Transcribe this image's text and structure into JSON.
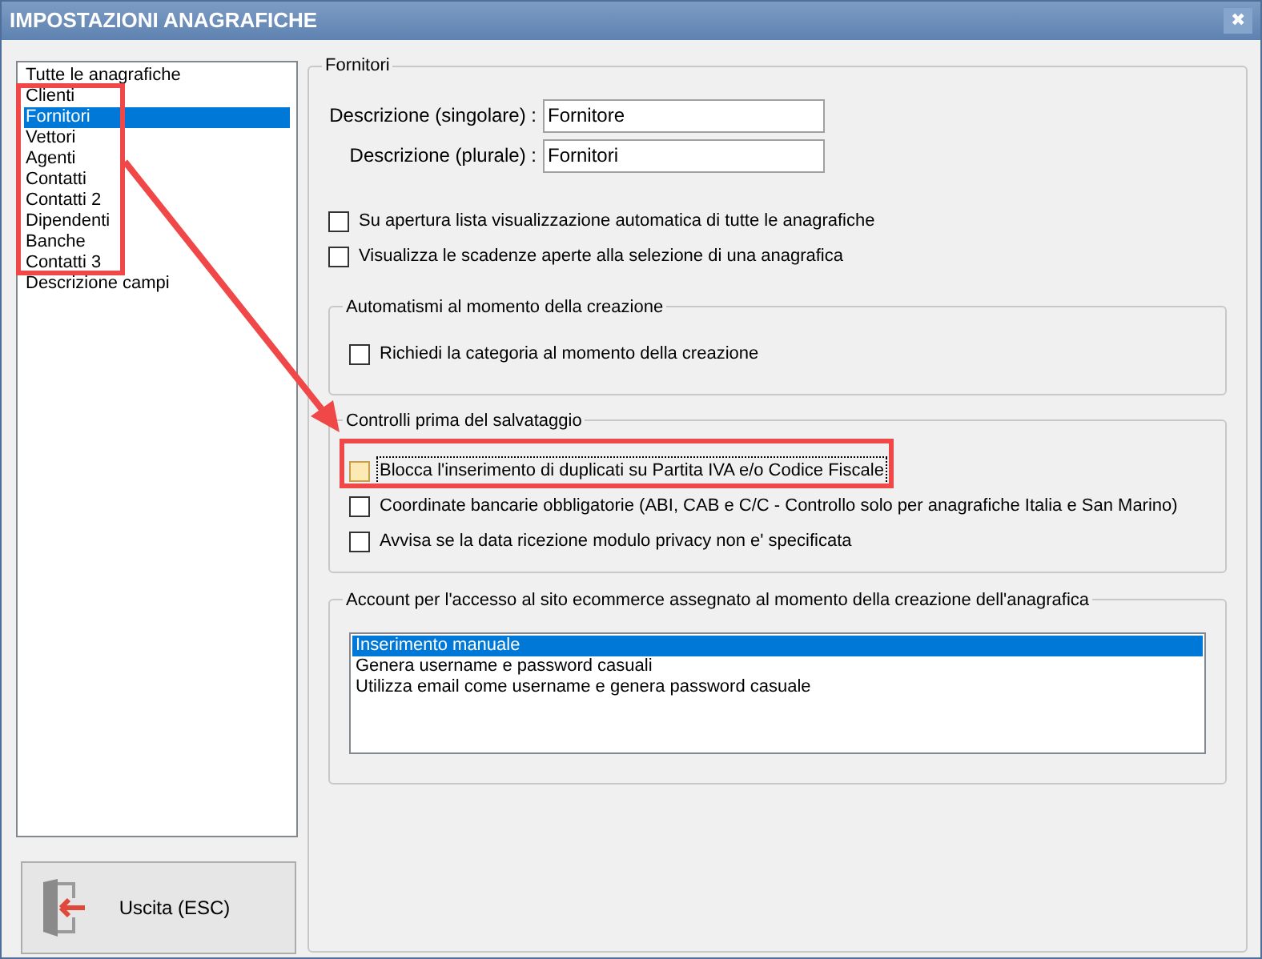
{
  "window": {
    "title": "IMPOSTAZIONI ANAGRAFICHE",
    "close": "✖"
  },
  "sidebar": {
    "items": [
      {
        "label": "Tutte le anagrafiche",
        "selected": false
      },
      {
        "label": "Clienti",
        "selected": false
      },
      {
        "label": "Fornitori",
        "selected": true
      },
      {
        "label": "Vettori",
        "selected": false
      },
      {
        "label": "Agenti",
        "selected": false
      },
      {
        "label": "Contatti",
        "selected": false
      },
      {
        "label": "Contatti 2",
        "selected": false
      },
      {
        "label": "Dipendenti",
        "selected": false
      },
      {
        "label": "Banche",
        "selected": false
      },
      {
        "label": "Contatti 3",
        "selected": false
      },
      {
        "label": "Descrizione campi",
        "selected": false
      }
    ]
  },
  "exit_button": "Uscita (ESC)",
  "panel": {
    "title": "Fornitori",
    "fields": [
      {
        "label": "Descrizione (singolare) :",
        "value": "Fornitore"
      },
      {
        "label": "Descrizione (plurale) :",
        "value": "Fornitori"
      }
    ],
    "options": [
      {
        "label": "Su apertura lista visualizzazione automatica di tutte le anagrafiche",
        "checked": false,
        "focused": false
      },
      {
        "label": "Visualizza le scadenze aperte alla selezione di una anagrafica",
        "checked": false,
        "focused": false
      }
    ],
    "groups": [
      {
        "title": "Automatismi al momento della creazione",
        "options": [
          {
            "label": "Richiedi la categoria al momento della creazione",
            "checked": false,
            "focused": false
          }
        ]
      },
      {
        "title": "Controlli prima del salvataggio",
        "options": [
          {
            "label": "Blocca l'inserimento di duplicati su Partita IVA e/o Codice Fiscale",
            "checked": false,
            "focused": true
          },
          {
            "label": "Coordinate bancarie obbligatorie (ABI, CAB e C/C - Controllo solo per anagrafiche Italia e San Marino)",
            "checked": false,
            "focused": false
          },
          {
            "label": "Avvisa se la data ricezione modulo privacy non e' specificata",
            "checked": false,
            "focused": false
          }
        ]
      }
    ],
    "account": {
      "title": "Account per l'accesso al sito ecommerce assegnato al momento della creazione dell'anagrafica",
      "items": [
        {
          "label": "Inserimento manuale",
          "selected": true
        },
        {
          "label": "Genera username e password casuali",
          "selected": false
        },
        {
          "label": "Utilizza email come username e genera password casuale",
          "selected": false
        }
      ]
    }
  }
}
